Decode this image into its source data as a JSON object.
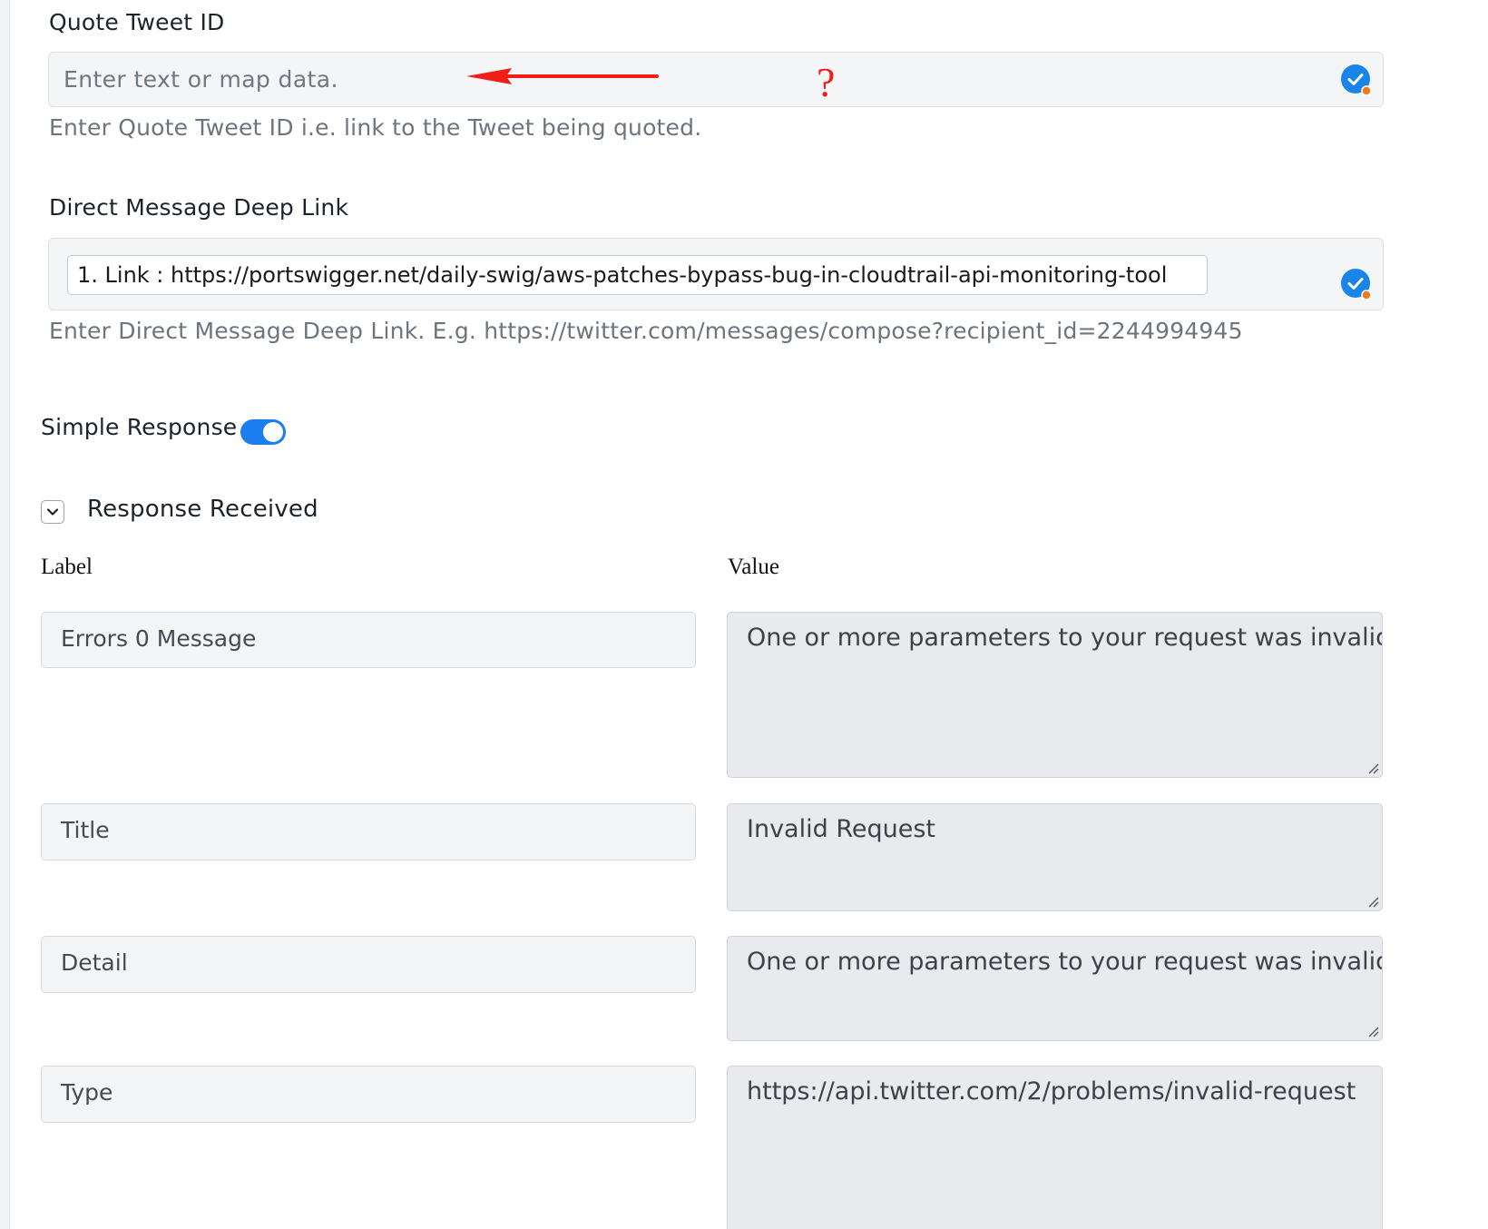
{
  "quote_tweet": {
    "label": "Quote Tweet ID",
    "placeholder": "Enter text or map data.",
    "help": "Enter Quote Tweet ID i.e. link to the Tweet being quoted.",
    "annotation_mark": "?",
    "annotation_color": "#f01e14",
    "status_icon": "check-circle-icon"
  },
  "dm_deep_link": {
    "label": "Direct Message Deep Link",
    "value": "1. Link : https://portswigger.net/daily-swig/aws-patches-bypass-bug-in-cloudtrail-api-monitoring-tool",
    "help": "Enter Direct Message Deep Link. E.g. https://twitter.com/messages/compose?recipient_id=2244994945",
    "status_icon": "check-circle-icon"
  },
  "simple_response": {
    "label": "Simple Response",
    "enabled": true,
    "accent_color": "#1a7df0"
  },
  "response_received": {
    "title": "Response Received",
    "expanded": true,
    "columns": {
      "label": "Label",
      "value": "Value"
    },
    "rows": [
      {
        "label": "Errors 0 Message",
        "value": "One or more parameters to your request was invalid"
      },
      {
        "label": "Title",
        "value": "Invalid Request"
      },
      {
        "label": "Detail",
        "value": "One or more parameters to your request was invalid."
      },
      {
        "label": "Type",
        "value": "https://api.twitter.com/2/problems/invalid-request"
      }
    ]
  }
}
